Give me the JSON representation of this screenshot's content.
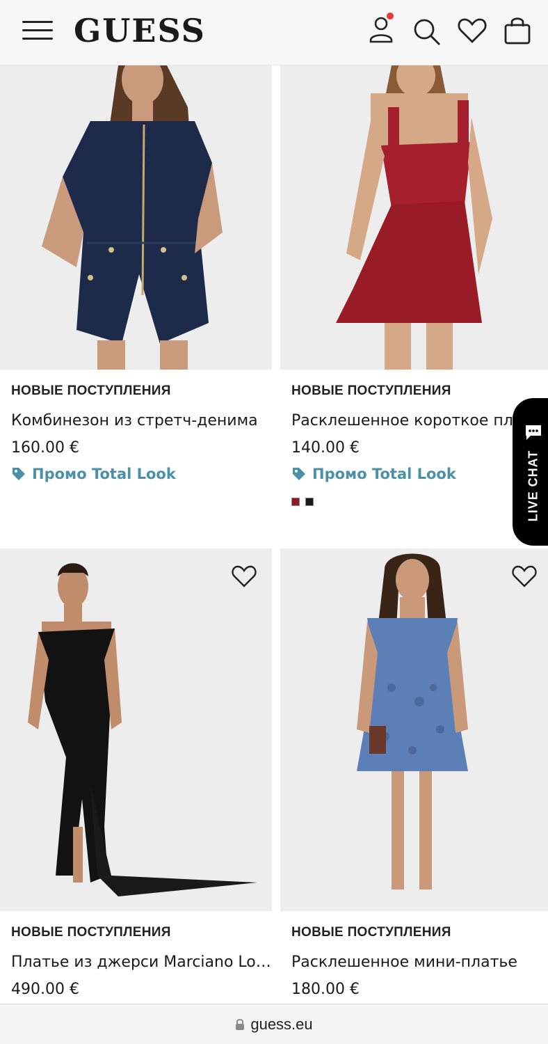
{
  "header": {
    "brand": "GUESS",
    "icons": [
      "menu-icon",
      "account-icon",
      "search-icon",
      "wishlist-icon",
      "bag-icon"
    ],
    "has_notification": true
  },
  "products": [
    {
      "category": "НОВЫЕ ПОСТУПЛЕНИЯ",
      "name": "Комбинезон из стретч-денима",
      "price": "160.00 €",
      "promo": "Промо Total Look"
    },
    {
      "category": "НОВЫЕ ПОСТУПЛЕНИЯ",
      "name": "Расклешенное короткое платье",
      "price": "140.00 €",
      "promo": "Промо Total Look",
      "swatches": [
        "#8b1a24",
        "#1a1a1a"
      ]
    },
    {
      "category": "НОВЫЕ ПОСТУПЛЕНИЯ",
      "name": "Платье из джерси Marciano Los Angeles",
      "price": "490.00 €"
    },
    {
      "category": "НОВЫЕ ПОСТУПЛЕНИЯ",
      "name": "Расклешенное мини-платье",
      "price": "180.00 €"
    }
  ],
  "live_chat": {
    "label": "LIVE CHAT"
  },
  "browser": {
    "url": "guess.eu"
  },
  "colors": {
    "promo": "#4a90a8",
    "chat_bg": "#000000",
    "header_bg": "#f7f7f7"
  }
}
